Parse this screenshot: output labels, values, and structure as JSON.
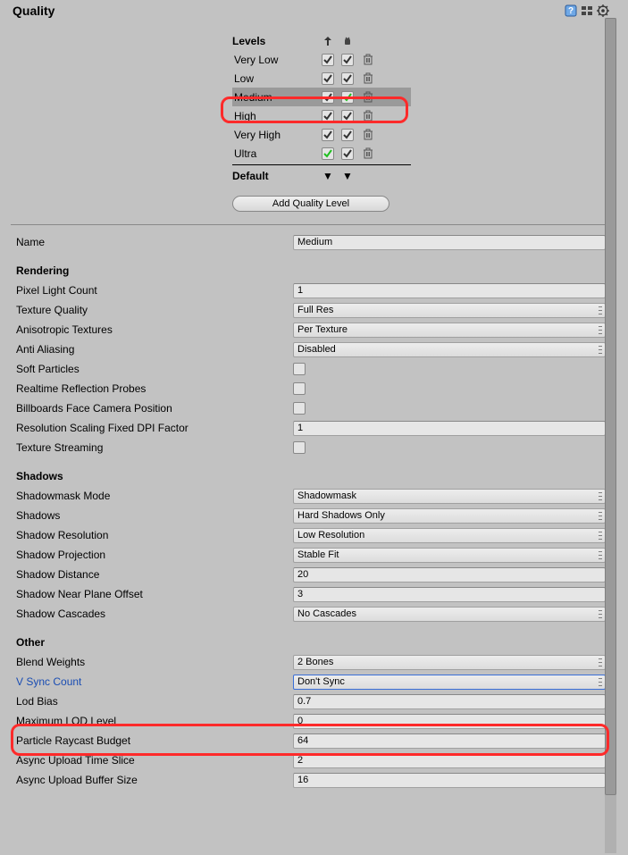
{
  "title": "Quality",
  "levels_header": "Levels",
  "levels": [
    {
      "name": "Very Low",
      "chk1": true,
      "chk2": true,
      "selected": false,
      "green": [
        false,
        false
      ]
    },
    {
      "name": "Low",
      "chk1": true,
      "chk2": true,
      "selected": false,
      "green": [
        false,
        false
      ]
    },
    {
      "name": "Medium",
      "chk1": true,
      "chk2": true,
      "selected": true,
      "green": [
        false,
        true
      ]
    },
    {
      "name": "High",
      "chk1": true,
      "chk2": true,
      "selected": false,
      "green": [
        false,
        false
      ]
    },
    {
      "name": "Very High",
      "chk1": true,
      "chk2": true,
      "selected": false,
      "green": [
        false,
        false
      ]
    },
    {
      "name": "Ultra",
      "chk1": true,
      "chk2": true,
      "selected": false,
      "green": [
        true,
        false
      ]
    }
  ],
  "default_label": "Default",
  "add_button": "Add Quality Level",
  "name_label": "Name",
  "name_value": "Medium",
  "sections": {
    "rendering": "Rendering",
    "shadows": "Shadows",
    "other": "Other"
  },
  "rendering": {
    "pixel_light_count": {
      "label": "Pixel Light Count",
      "value": "1"
    },
    "texture_quality": {
      "label": "Texture Quality",
      "value": "Full Res"
    },
    "anisotropic": {
      "label": "Anisotropic Textures",
      "value": "Per Texture"
    },
    "anti_aliasing": {
      "label": "Anti Aliasing",
      "value": "Disabled"
    },
    "soft_particles": {
      "label": "Soft Particles"
    },
    "reflection_probes": {
      "label": "Realtime Reflection Probes"
    },
    "billboards": {
      "label": "Billboards Face Camera Position"
    },
    "res_scaling": {
      "label": "Resolution Scaling Fixed DPI Factor",
      "value": "1"
    },
    "tex_streaming": {
      "label": "Texture Streaming"
    }
  },
  "shadows": {
    "shadowmask": {
      "label": "Shadowmask Mode",
      "value": "Shadowmask"
    },
    "shadows": {
      "label": "Shadows",
      "value": "Hard Shadows Only"
    },
    "resolution": {
      "label": "Shadow Resolution",
      "value": "Low Resolution"
    },
    "projection": {
      "label": "Shadow Projection",
      "value": "Stable Fit"
    },
    "distance": {
      "label": "Shadow Distance",
      "value": "20"
    },
    "near_plane": {
      "label": "Shadow Near Plane Offset",
      "value": "3"
    },
    "cascades": {
      "label": "Shadow Cascades",
      "value": "No Cascades"
    }
  },
  "other": {
    "blend_weights": {
      "label": "Blend Weights",
      "value": "2 Bones"
    },
    "vsync": {
      "label": "V Sync Count",
      "value": "Don't Sync"
    },
    "lod_bias": {
      "label": "Lod Bias",
      "value": "0.7"
    },
    "max_lod": {
      "label": "Maximum LOD Level",
      "value": "0"
    },
    "raycast": {
      "label": "Particle Raycast Budget",
      "value": "64"
    },
    "upload_time": {
      "label": "Async Upload Time Slice",
      "value": "2"
    },
    "upload_buf": {
      "label": "Async Upload Buffer Size",
      "value": "16"
    }
  }
}
